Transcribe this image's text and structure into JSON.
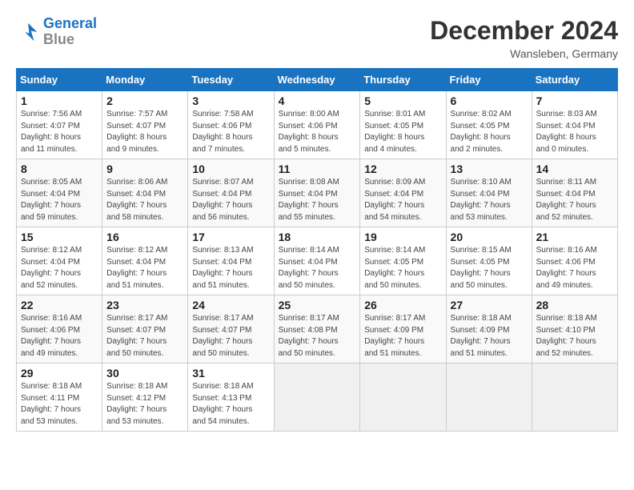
{
  "header": {
    "logo_line1": "General",
    "logo_line2": "Blue",
    "month": "December 2024",
    "location": "Wansleben, Germany"
  },
  "days_of_week": [
    "Sunday",
    "Monday",
    "Tuesday",
    "Wednesday",
    "Thursday",
    "Friday",
    "Saturday"
  ],
  "weeks": [
    [
      {
        "day": "1",
        "info": "Sunrise: 7:56 AM\nSunset: 4:07 PM\nDaylight: 8 hours\nand 11 minutes."
      },
      {
        "day": "2",
        "info": "Sunrise: 7:57 AM\nSunset: 4:07 PM\nDaylight: 8 hours\nand 9 minutes."
      },
      {
        "day": "3",
        "info": "Sunrise: 7:58 AM\nSunset: 4:06 PM\nDaylight: 8 hours\nand 7 minutes."
      },
      {
        "day": "4",
        "info": "Sunrise: 8:00 AM\nSunset: 4:06 PM\nDaylight: 8 hours\nand 5 minutes."
      },
      {
        "day": "5",
        "info": "Sunrise: 8:01 AM\nSunset: 4:05 PM\nDaylight: 8 hours\nand 4 minutes."
      },
      {
        "day": "6",
        "info": "Sunrise: 8:02 AM\nSunset: 4:05 PM\nDaylight: 8 hours\nand 2 minutes."
      },
      {
        "day": "7",
        "info": "Sunrise: 8:03 AM\nSunset: 4:04 PM\nDaylight: 8 hours\nand 0 minutes."
      }
    ],
    [
      {
        "day": "8",
        "info": "Sunrise: 8:05 AM\nSunset: 4:04 PM\nDaylight: 7 hours\nand 59 minutes."
      },
      {
        "day": "9",
        "info": "Sunrise: 8:06 AM\nSunset: 4:04 PM\nDaylight: 7 hours\nand 58 minutes."
      },
      {
        "day": "10",
        "info": "Sunrise: 8:07 AM\nSunset: 4:04 PM\nDaylight: 7 hours\nand 56 minutes."
      },
      {
        "day": "11",
        "info": "Sunrise: 8:08 AM\nSunset: 4:04 PM\nDaylight: 7 hours\nand 55 minutes."
      },
      {
        "day": "12",
        "info": "Sunrise: 8:09 AM\nSunset: 4:04 PM\nDaylight: 7 hours\nand 54 minutes."
      },
      {
        "day": "13",
        "info": "Sunrise: 8:10 AM\nSunset: 4:04 PM\nDaylight: 7 hours\nand 53 minutes."
      },
      {
        "day": "14",
        "info": "Sunrise: 8:11 AM\nSunset: 4:04 PM\nDaylight: 7 hours\nand 52 minutes."
      }
    ],
    [
      {
        "day": "15",
        "info": "Sunrise: 8:12 AM\nSunset: 4:04 PM\nDaylight: 7 hours\nand 52 minutes."
      },
      {
        "day": "16",
        "info": "Sunrise: 8:12 AM\nSunset: 4:04 PM\nDaylight: 7 hours\nand 51 minutes."
      },
      {
        "day": "17",
        "info": "Sunrise: 8:13 AM\nSunset: 4:04 PM\nDaylight: 7 hours\nand 51 minutes."
      },
      {
        "day": "18",
        "info": "Sunrise: 8:14 AM\nSunset: 4:04 PM\nDaylight: 7 hours\nand 50 minutes."
      },
      {
        "day": "19",
        "info": "Sunrise: 8:14 AM\nSunset: 4:05 PM\nDaylight: 7 hours\nand 50 minutes."
      },
      {
        "day": "20",
        "info": "Sunrise: 8:15 AM\nSunset: 4:05 PM\nDaylight: 7 hours\nand 50 minutes."
      },
      {
        "day": "21",
        "info": "Sunrise: 8:16 AM\nSunset: 4:06 PM\nDaylight: 7 hours\nand 49 minutes."
      }
    ],
    [
      {
        "day": "22",
        "info": "Sunrise: 8:16 AM\nSunset: 4:06 PM\nDaylight: 7 hours\nand 49 minutes."
      },
      {
        "day": "23",
        "info": "Sunrise: 8:17 AM\nSunset: 4:07 PM\nDaylight: 7 hours\nand 50 minutes."
      },
      {
        "day": "24",
        "info": "Sunrise: 8:17 AM\nSunset: 4:07 PM\nDaylight: 7 hours\nand 50 minutes."
      },
      {
        "day": "25",
        "info": "Sunrise: 8:17 AM\nSunset: 4:08 PM\nDaylight: 7 hours\nand 50 minutes."
      },
      {
        "day": "26",
        "info": "Sunrise: 8:17 AM\nSunset: 4:09 PM\nDaylight: 7 hours\nand 51 minutes."
      },
      {
        "day": "27",
        "info": "Sunrise: 8:18 AM\nSunset: 4:09 PM\nDaylight: 7 hours\nand 51 minutes."
      },
      {
        "day": "28",
        "info": "Sunrise: 8:18 AM\nSunset: 4:10 PM\nDaylight: 7 hours\nand 52 minutes."
      }
    ],
    [
      {
        "day": "29",
        "info": "Sunrise: 8:18 AM\nSunset: 4:11 PM\nDaylight: 7 hours\nand 53 minutes."
      },
      {
        "day": "30",
        "info": "Sunrise: 8:18 AM\nSunset: 4:12 PM\nDaylight: 7 hours\nand 53 minutes."
      },
      {
        "day": "31",
        "info": "Sunrise: 8:18 AM\nSunset: 4:13 PM\nDaylight: 7 hours\nand 54 minutes."
      },
      null,
      null,
      null,
      null
    ]
  ]
}
